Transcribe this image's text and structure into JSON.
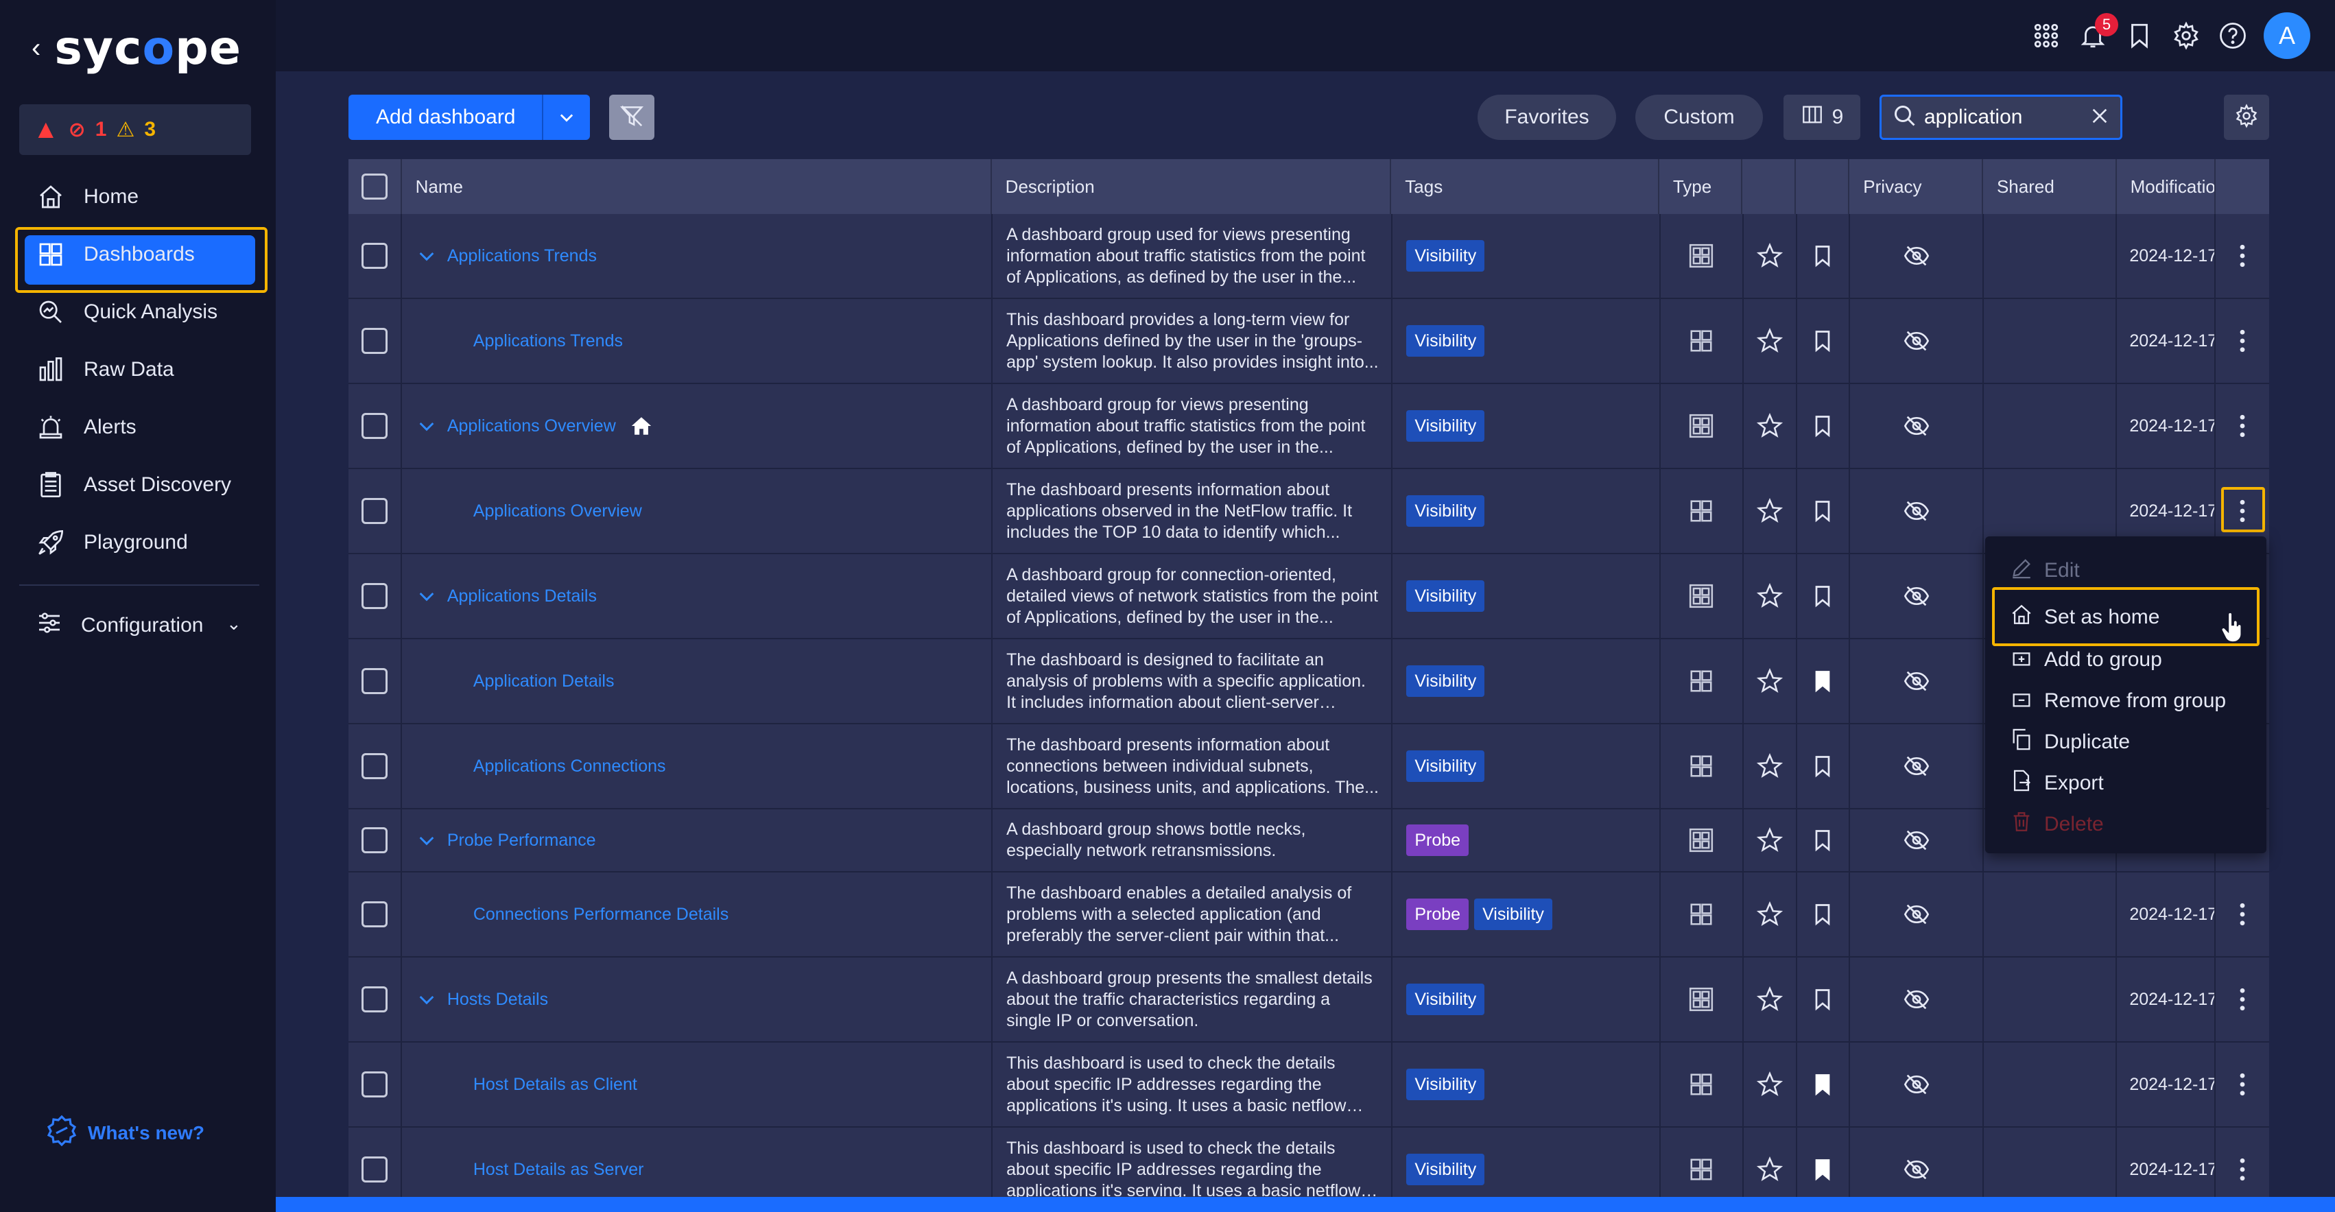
{
  "brand": {
    "name_pre": "syc",
    "name_o": "o",
    "name_post": "pe"
  },
  "alerts": {
    "critical": "",
    "errors": "1",
    "warnings": "3"
  },
  "nav": [
    {
      "label": "Home",
      "icon": "home-icon"
    },
    {
      "label": "Dashboards",
      "icon": "dashboards-icon",
      "active": true
    },
    {
      "label": "Quick Analysis",
      "icon": "quick-analysis-icon"
    },
    {
      "label": "Raw Data",
      "icon": "raw-data-icon"
    },
    {
      "label": "Alerts",
      "icon": "alerts-icon"
    },
    {
      "label": "Asset Discovery",
      "icon": "asset-discovery-icon"
    },
    {
      "label": "Playground",
      "icon": "playground-icon"
    }
  ],
  "config_label": "Configuration",
  "whats_new": "What's new?",
  "notifications_count": "5",
  "avatar_initial": "A",
  "toolbar": {
    "add_dashboard": "Add dashboard",
    "favorites": "Favorites",
    "custom": "Custom",
    "columns_count": "9",
    "search_value": "application"
  },
  "columns": {
    "name": "Name",
    "description": "Description",
    "tags": "Tags",
    "type": "Type",
    "privacy": "Privacy",
    "shared": "Shared",
    "modification": "Modificatio"
  },
  "rows": [
    {
      "name": "Applications Trends",
      "group": true,
      "desc": "A dashboard group used for views presenting information about traffic statistics from the point of Applications, as defined by the user in the...",
      "tags": [
        "Visibility"
      ],
      "date": "2024-12-17",
      "bookmarked": false
    },
    {
      "name": "Applications Trends",
      "group": false,
      "desc": "This dashboard provides a long-term view for Applications defined by the user in the 'groups-app' system lookup. It also provides insight into...",
      "tags": [
        "Visibility"
      ],
      "date": "2024-12-17",
      "bookmarked": false
    },
    {
      "name": "Applications Overview",
      "group": true,
      "home": true,
      "desc": "A dashboard group for views presenting information about traffic statistics from the point of Applications, defined by the user in the...",
      "tags": [
        "Visibility"
      ],
      "date": "2024-12-17",
      "bookmarked": false
    },
    {
      "name": "Applications Overview",
      "group": false,
      "desc": "The dashboard presents information about applications observed in the NetFlow traffic. It includes the TOP 10 data to identify which...",
      "tags": [
        "Visibility"
      ],
      "date": "2024-12-17",
      "bookmarked": false
    },
    {
      "name": "Applications Details",
      "group": true,
      "desc": "A dashboard group for connection-oriented, detailed views of network statistics from the point of Applications, defined by the user in the...",
      "tags": [
        "Visibility"
      ],
      "date": "",
      "bookmarked": false
    },
    {
      "name": "Application Details",
      "group": false,
      "desc": "The dashboard is designed to facilitate an analysis of problems with a specific application. It includes information about client-server conversations...",
      "tags": [
        "Visibility"
      ],
      "date": "",
      "bookmarked": true
    },
    {
      "name": "Applications Connections",
      "group": false,
      "desc": "The dashboard presents information about connections between individual subnets, locations, business units, and applications. The...",
      "tags": [
        "Visibility"
      ],
      "date": "",
      "bookmarked": false
    },
    {
      "name": "Probe Performance",
      "group": true,
      "desc": "A dashboard group shows bottle necks, especially network retransmissions.",
      "tags": [
        "Probe"
      ],
      "date": "",
      "bookmarked": false
    },
    {
      "name": "Connections Performance Details",
      "group": false,
      "desc": "The dashboard enables a detailed analysis of problems with a selected application (and preferably the server-client pair within that...",
      "tags": [
        "Probe",
        "Visibility"
      ],
      "date": "2024-12-17",
      "bookmarked": false
    },
    {
      "name": "Hosts Details",
      "group": true,
      "desc": "A dashboard group presents the smallest details about the traffic characteristics regarding a single IP or conversation.",
      "tags": [
        "Visibility"
      ],
      "date": "2024-12-17",
      "bookmarked": false
    },
    {
      "name": "Host Details as Client",
      "group": false,
      "desc": "This dashboard is used to check the details about specific IP addresses regarding the applications it's using. It uses a basic netflow stream, which is...",
      "tags": [
        "Visibility"
      ],
      "date": "2024-12-17",
      "bookmarked": true
    },
    {
      "name": "Host Details as Server",
      "group": false,
      "desc": "This dashboard is used to check the details about specific IP addresses regarding the applications it's serving. It uses a basic netflow stream, which i...",
      "tags": [
        "Visibility"
      ],
      "date": "2024-12-17",
      "bookmarked": true
    }
  ],
  "menu": {
    "edit": "Edit",
    "set_home": "Set as home",
    "add_group": "Add to group",
    "remove_group": "Remove from group",
    "duplicate": "Duplicate",
    "export": "Export",
    "delete": "Delete"
  }
}
